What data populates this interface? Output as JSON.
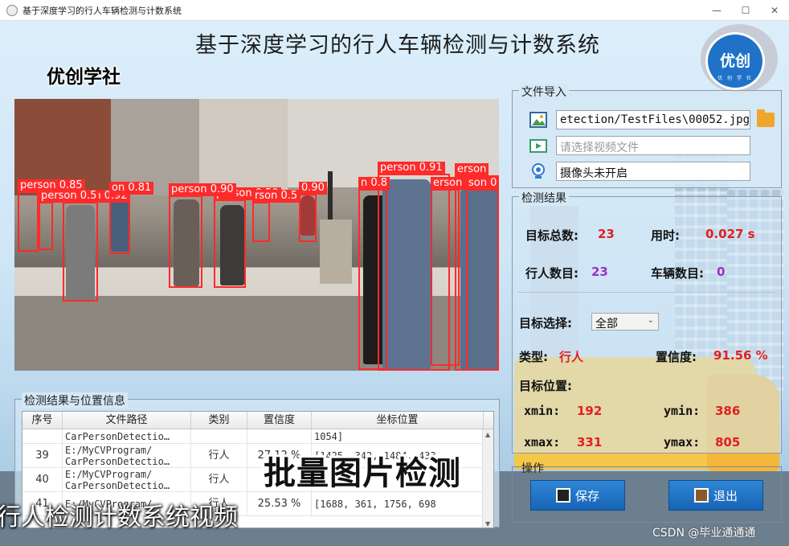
{
  "window": {
    "title": "基于深度学习的行人车辆检测与计数系统",
    "controls": [
      "—",
      "☐",
      "✕"
    ]
  },
  "app_title": "基于深度学习的行人车辆检测与计数系统",
  "brand": "优创学社",
  "logo": {
    "text": "优创",
    "sub": "优 创 学 社"
  },
  "image_view": {
    "detections": [
      {
        "label": "person 0.91"
      },
      {
        "label": "erson"
      },
      {
        "label": "person 0.85"
      },
      {
        "label": "person 0.92"
      },
      {
        "label": "on 0.81"
      },
      {
        "label": "person 0.5"
      },
      {
        "label": "person 0.50"
      },
      {
        "label": "person 0.90"
      },
      {
        "label": "0.90"
      },
      {
        "label": "n 0.8"
      },
      {
        "label": "erson 0.80"
      },
      {
        "label": "son 0"
      },
      {
        "label": "rson 0.5"
      }
    ]
  },
  "file_import": {
    "legend": "文件导入",
    "image_path": "etection/TestFiles\\00052.jpg",
    "video_placeholder": "请选择视频文件",
    "camera_status": "摄像头未开启"
  },
  "results": {
    "legend": "检测结果",
    "total_label": "目标总数:",
    "total_value": "23",
    "time_label": "用时:",
    "time_value": "0.027 s",
    "pedestrian_label": "行人数目:",
    "pedestrian_value": "23",
    "vehicle_label": "车辆数目:",
    "vehicle_value": "0",
    "target_select_label": "目标选择:",
    "target_select_value": "全部",
    "type_label": "类型:",
    "type_value": "行人",
    "confidence_label": "置信度:",
    "confidence_value": "91.56 %",
    "position_label": "目标位置:",
    "xmin_label": "xmin:",
    "xmin_value": "192",
    "ymin_label": "ymin:",
    "ymin_value": "386",
    "xmax_label": "xmax:",
    "xmax_value": "331",
    "ymax_label": "ymax:",
    "ymax_value": "805"
  },
  "operations": {
    "legend": "操作",
    "save_label": "保存",
    "exit_label": "退出"
  },
  "table": {
    "legend": "检测结果与位置信息",
    "headers": [
      "序号",
      "文件路径",
      "类别",
      "置信度",
      "坐标位置"
    ],
    "rows": [
      {
        "idx": "",
        "path": "CarPersonDetectio…",
        "cls": "",
        "conf": "",
        "coords": "1054]"
      },
      {
        "idx": "39",
        "path": "E:/MyCVProgram/\nCarPersonDetectio…",
        "cls": "行人",
        "conf": "27.12 %",
        "coords": "[1425, 342, 1484, 433"
      },
      {
        "idx": "40",
        "path": "E:/MyCVProgram/\nCarPersonDetectio…",
        "cls": "行人",
        "conf": "",
        "coords": ""
      },
      {
        "idx": "41",
        "path": "E:/MyCVProgram/",
        "cls": "行人",
        "conf": "25.53 %",
        "coords": "[1688, 361, 1756, 698"
      }
    ]
  },
  "overlays": {
    "big_caption": "批量图片检测",
    "video_caption": "行人检测计数系统视频",
    "watermark": "CSDN @毕业通通通"
  },
  "colors": {
    "detection_box": "#ff2a2a",
    "value_red": "#e02020",
    "value_purple": "#9b2fc9",
    "button_blue": "#1f72c8"
  }
}
